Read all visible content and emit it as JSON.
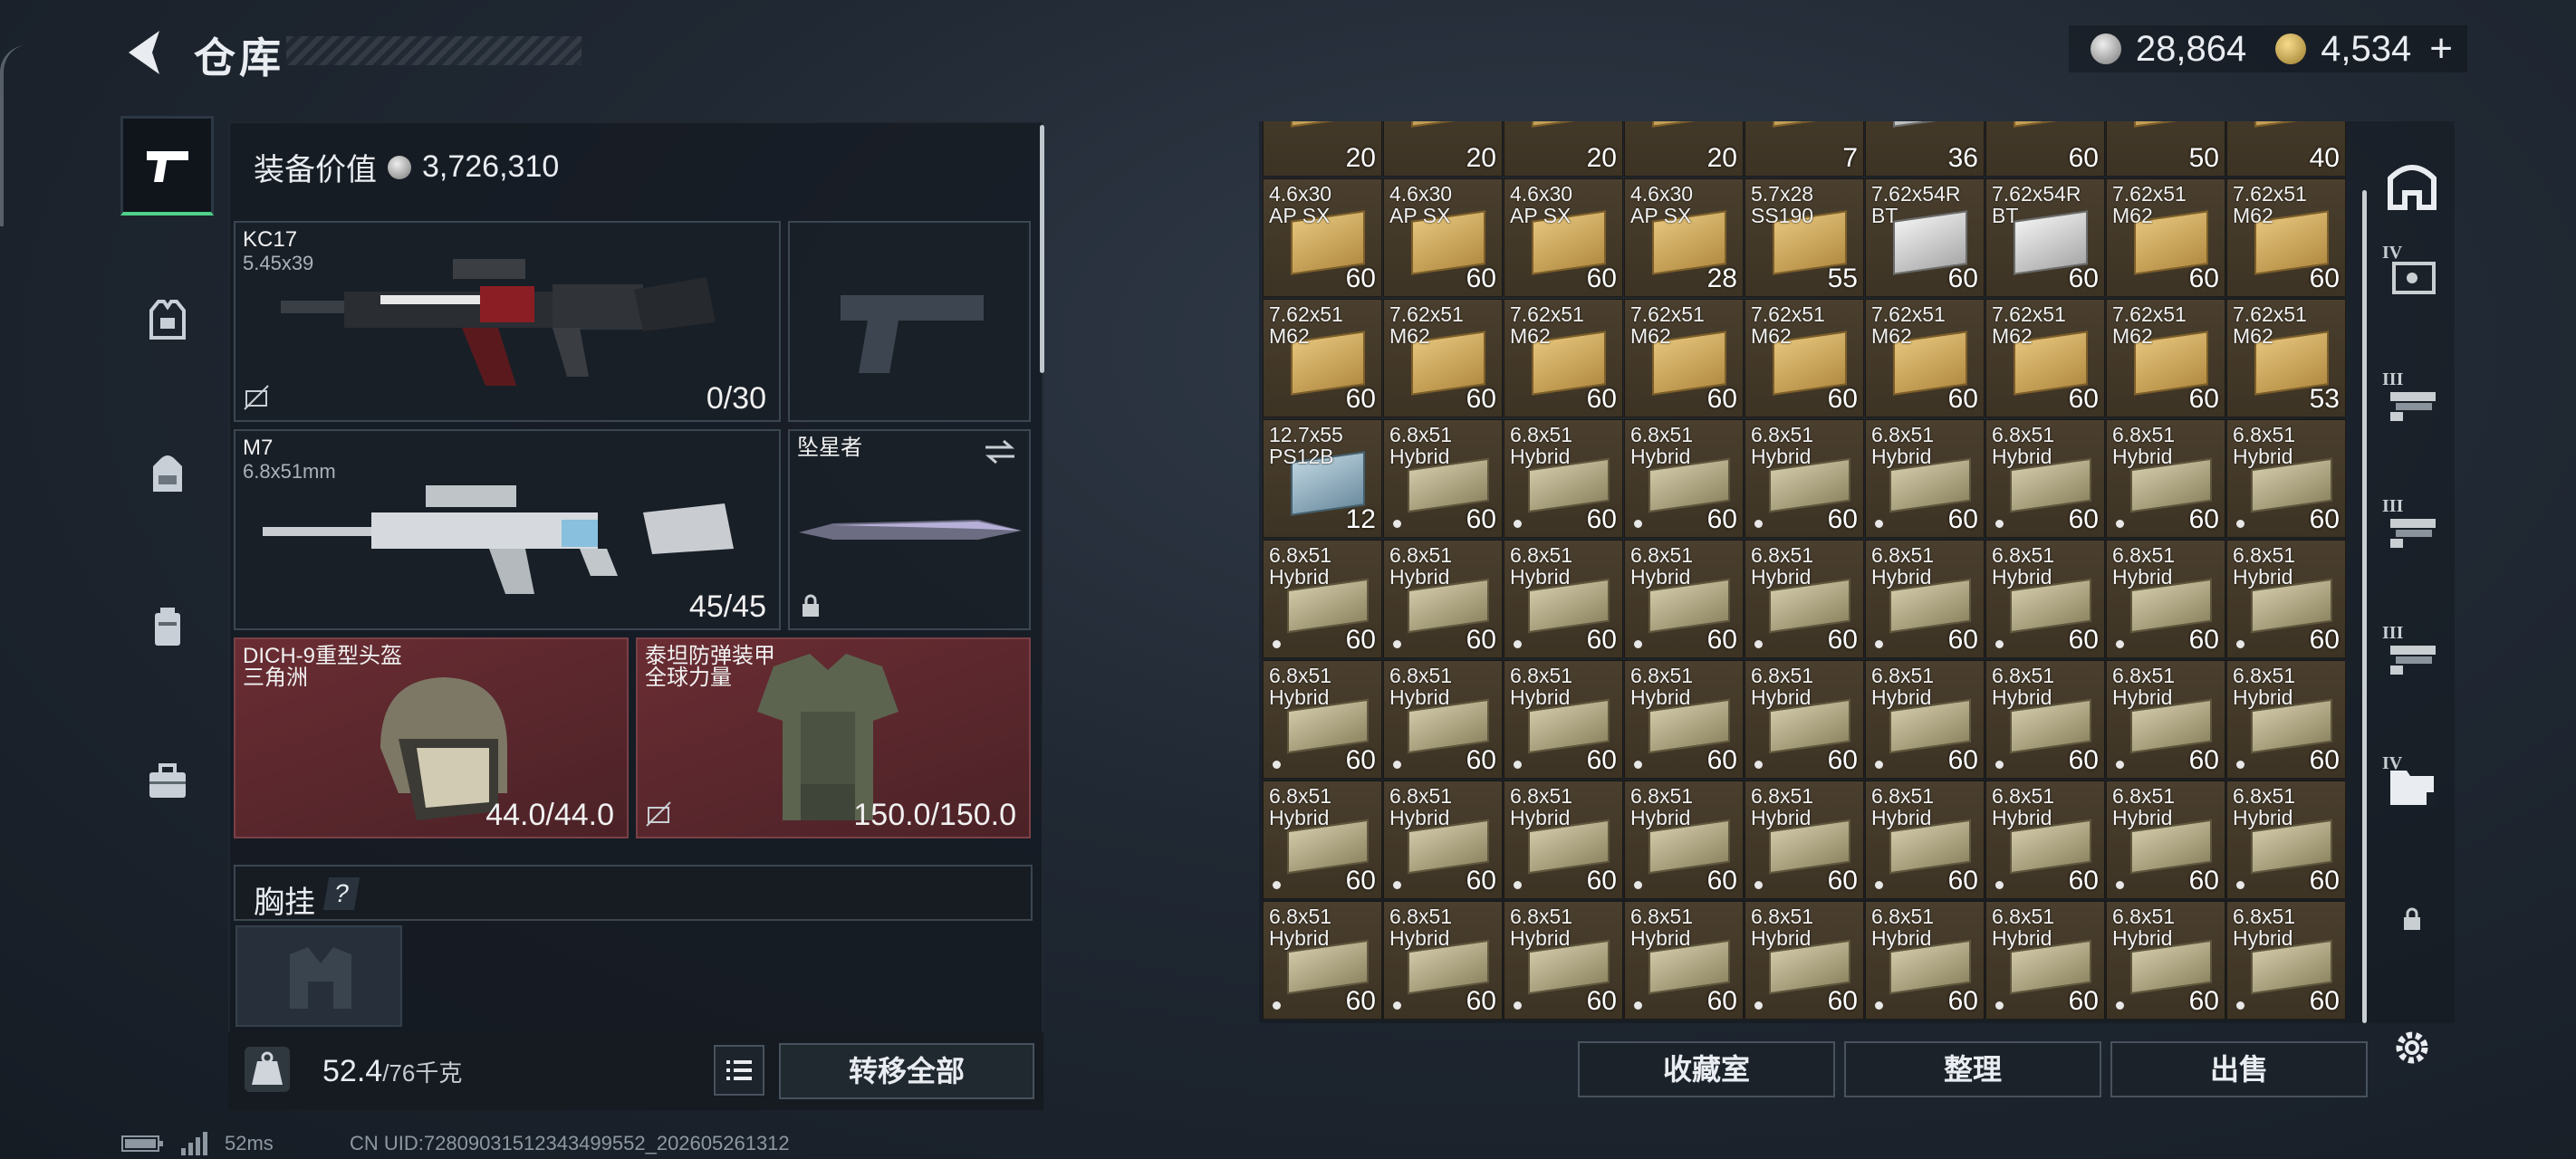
{
  "header": {
    "title": "仓库",
    "back": "back-arrow",
    "currency_silver": "28,864",
    "currency_gold": "4,534"
  },
  "loadout": {
    "value_label": "装备价值",
    "value": "3,726,310",
    "primary": {
      "name": "KC17",
      "caliber": "5.45x39",
      "ammo": "0/30"
    },
    "secondary": {
      "name": "M7",
      "caliber": "6.8x51mm",
      "ammo": "45/45"
    },
    "melee": {
      "name": "坠星者"
    },
    "helmet": {
      "name": "DICH-9重型头盔",
      "origin": "三角洲",
      "durability": "44.0/44.0"
    },
    "armor": {
      "name": "泰坦防弹装甲",
      "origin": "全球力量",
      "durability": "150.0/150.0"
    },
    "chest_label": "胸挂",
    "chest_hint": "?",
    "weight": "52.4",
    "weight_max": "/76千克",
    "transfer_all": "转移全部"
  },
  "storage": {
    "buttons": [
      "收藏室",
      "整理",
      "出售"
    ],
    "top_row_counts": [
      "20",
      "20",
      "20",
      "20",
      "7",
      "36",
      "60",
      "50",
      "40"
    ],
    "rows": [
      [
        {
          "l1": "4.6x30",
          "l2": "AP SX",
          "q": "60",
          "t": "yel"
        },
        {
          "l1": "4.6x30",
          "l2": "AP SX",
          "q": "60",
          "t": "yel"
        },
        {
          "l1": "4.6x30",
          "l2": "AP SX",
          "q": "60",
          "t": "yel"
        },
        {
          "l1": "4.6x30",
          "l2": "AP SX",
          "q": "28",
          "t": "yel"
        },
        {
          "l1": "5.7x28",
          "l2": "SS190",
          "q": "55",
          "t": "yel"
        },
        {
          "l1": "7.62x54R",
          "l2": "BT",
          "q": "60",
          "t": "wht"
        },
        {
          "l1": "7.62x54R",
          "l2": "BT",
          "q": "60",
          "t": "wht"
        },
        {
          "l1": "7.62x51",
          "l2": "M62",
          "q": "60",
          "t": "yel"
        },
        {
          "l1": "7.62x51",
          "l2": "M62",
          "q": "60",
          "t": "yel"
        }
      ],
      [
        {
          "l1": "7.62x51",
          "l2": "M62",
          "q": "60",
          "t": "yel"
        },
        {
          "l1": "7.62x51",
          "l2": "M62",
          "q": "60",
          "t": "yel"
        },
        {
          "l1": "7.62x51",
          "l2": "M62",
          "q": "60",
          "t": "yel"
        },
        {
          "l1": "7.62x51",
          "l2": "M62",
          "q": "60",
          "t": "yel"
        },
        {
          "l1": "7.62x51",
          "l2": "M62",
          "q": "60",
          "t": "yel"
        },
        {
          "l1": "7.62x51",
          "l2": "M62",
          "q": "60",
          "t": "yel"
        },
        {
          "l1": "7.62x51",
          "l2": "M62",
          "q": "60",
          "t": "yel"
        },
        {
          "l1": "7.62x51",
          "l2": "M62",
          "q": "60",
          "t": "yel"
        },
        {
          "l1": "7.62x51",
          "l2": "M62",
          "q": "53",
          "t": "yel"
        }
      ],
      [
        {
          "l1": "12.7x55",
          "l2": "PS12B",
          "q": "12",
          "t": "blu"
        },
        {
          "l1": "6.8x51",
          "l2": "Hybrid",
          "q": "60",
          "t": "hyb",
          "d": true
        },
        {
          "l1": "6.8x51",
          "l2": "Hybrid",
          "q": "60",
          "t": "hyb",
          "d": true
        },
        {
          "l1": "6.8x51",
          "l2": "Hybrid",
          "q": "60",
          "t": "hyb",
          "d": true
        },
        {
          "l1": "6.8x51",
          "l2": "Hybrid",
          "q": "60",
          "t": "hyb",
          "d": true
        },
        {
          "l1": "6.8x51",
          "l2": "Hybrid",
          "q": "60",
          "t": "hyb",
          "d": true
        },
        {
          "l1": "6.8x51",
          "l2": "Hybrid",
          "q": "60",
          "t": "hyb",
          "d": true
        },
        {
          "l1": "6.8x51",
          "l2": "Hybrid",
          "q": "60",
          "t": "hyb",
          "d": true
        },
        {
          "l1": "6.8x51",
          "l2": "Hybrid",
          "q": "60",
          "t": "hyb",
          "d": true
        }
      ],
      [
        {
          "l1": "6.8x51",
          "l2": "Hybrid",
          "q": "60",
          "t": "hyb",
          "d": true
        },
        {
          "l1": "6.8x51",
          "l2": "Hybrid",
          "q": "60",
          "t": "hyb",
          "d": true
        },
        {
          "l1": "6.8x51",
          "l2": "Hybrid",
          "q": "60",
          "t": "hyb",
          "d": true
        },
        {
          "l1": "6.8x51",
          "l2": "Hybrid",
          "q": "60",
          "t": "hyb",
          "d": true
        },
        {
          "l1": "6.8x51",
          "l2": "Hybrid",
          "q": "60",
          "t": "hyb",
          "d": true
        },
        {
          "l1": "6.8x51",
          "l2": "Hybrid",
          "q": "60",
          "t": "hyb",
          "d": true
        },
        {
          "l1": "6.8x51",
          "l2": "Hybrid",
          "q": "60",
          "t": "hyb",
          "d": true
        },
        {
          "l1": "6.8x51",
          "l2": "Hybrid",
          "q": "60",
          "t": "hyb",
          "d": true
        },
        {
          "l1": "6.8x51",
          "l2": "Hybrid",
          "q": "60",
          "t": "hyb",
          "d": true
        }
      ],
      [
        {
          "l1": "6.8x51",
          "l2": "Hybrid",
          "q": "60",
          "t": "hyb",
          "d": true
        },
        {
          "l1": "6.8x51",
          "l2": "Hybrid",
          "q": "60",
          "t": "hyb",
          "d": true
        },
        {
          "l1": "6.8x51",
          "l2": "Hybrid",
          "q": "60",
          "t": "hyb",
          "d": true
        },
        {
          "l1": "6.8x51",
          "l2": "Hybrid",
          "q": "60",
          "t": "hyb",
          "d": true
        },
        {
          "l1": "6.8x51",
          "l2": "Hybrid",
          "q": "60",
          "t": "hyb",
          "d": true
        },
        {
          "l1": "6.8x51",
          "l2": "Hybrid",
          "q": "60",
          "t": "hyb",
          "d": true
        },
        {
          "l1": "6.8x51",
          "l2": "Hybrid",
          "q": "60",
          "t": "hyb",
          "d": true
        },
        {
          "l1": "6.8x51",
          "l2": "Hybrid",
          "q": "60",
          "t": "hyb",
          "d": true
        },
        {
          "l1": "6.8x51",
          "l2": "Hybrid",
          "q": "60",
          "t": "hyb",
          "d": true
        }
      ],
      [
        {
          "l1": "6.8x51",
          "l2": "Hybrid",
          "q": "60",
          "t": "hyb",
          "d": true
        },
        {
          "l1": "6.8x51",
          "l2": "Hybrid",
          "q": "60",
          "t": "hyb",
          "d": true
        },
        {
          "l1": "6.8x51",
          "l2": "Hybrid",
          "q": "60",
          "t": "hyb",
          "d": true
        },
        {
          "l1": "6.8x51",
          "l2": "Hybrid",
          "q": "60",
          "t": "hyb",
          "d": true
        },
        {
          "l1": "6.8x51",
          "l2": "Hybrid",
          "q": "60",
          "t": "hyb",
          "d": true
        },
        {
          "l1": "6.8x51",
          "l2": "Hybrid",
          "q": "60",
          "t": "hyb",
          "d": true
        },
        {
          "l1": "6.8x51",
          "l2": "Hybrid",
          "q": "60",
          "t": "hyb",
          "d": true
        },
        {
          "l1": "6.8x51",
          "l2": "Hybrid",
          "q": "60",
          "t": "hyb",
          "d": true
        },
        {
          "l1": "6.8x51",
          "l2": "Hybrid",
          "q": "60",
          "t": "hyb",
          "d": true
        }
      ],
      [
        {
          "l1": "6.8x51",
          "l2": "Hybrid",
          "q": "60",
          "t": "hyb",
          "d": true
        },
        {
          "l1": "6.8x51",
          "l2": "Hybrid",
          "q": "60",
          "t": "hyb",
          "d": true
        },
        {
          "l1": "6.8x51",
          "l2": "Hybrid",
          "q": "60",
          "t": "hyb",
          "d": true
        },
        {
          "l1": "6.8x51",
          "l2": "Hybrid",
          "q": "60",
          "t": "hyb",
          "d": true
        },
        {
          "l1": "6.8x51",
          "l2": "Hybrid",
          "q": "60",
          "t": "hyb",
          "d": true
        },
        {
          "l1": "6.8x51",
          "l2": "Hybrid",
          "q": "60",
          "t": "hyb",
          "d": true
        },
        {
          "l1": "6.8x51",
          "l2": "Hybrid",
          "q": "60",
          "t": "hyb",
          "d": true
        },
        {
          "l1": "6.8x51",
          "l2": "Hybrid",
          "q": "60",
          "t": "hyb",
          "d": true
        },
        {
          "l1": "6.8x51",
          "l2": "Hybrid",
          "q": "60",
          "t": "hyb",
          "d": true
        }
      ]
    ]
  },
  "right_tabs": [
    {
      "icon": "vault-icon",
      "tier": ""
    },
    {
      "icon": "container-icon",
      "tier": "IV"
    },
    {
      "icon": "rack-icon",
      "tier": "III"
    },
    {
      "icon": "rack-icon",
      "tier": "III"
    },
    {
      "icon": "rack-icon",
      "tier": "III"
    },
    {
      "icon": "folder-icon",
      "tier": "IV"
    },
    {
      "icon": "lock-icon",
      "tier": ""
    }
  ],
  "status": {
    "ping": "52ms",
    "uid": "CN UID:72809031512343499552_202605261312"
  },
  "colors": {
    "accent_green": "#4fd18a",
    "slot_red": "#6a2d33",
    "ammo_cell": "#4a3f2e"
  }
}
